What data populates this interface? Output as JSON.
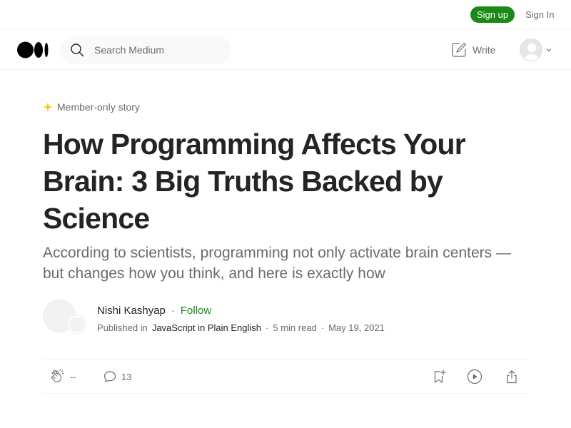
{
  "auth": {
    "signup_label": "Sign up",
    "signin_label": "Sign In"
  },
  "header": {
    "search_placeholder": "Search Medium",
    "write_label": "Write"
  },
  "article": {
    "member_badge": "Member-only story",
    "title": "How Programming Affects Your Brain: 3 Big Truths Backed by Science",
    "subtitle": "According to scientists, programming not only activate brain centers — but changes how you think, and here is exactly how",
    "author": {
      "name": "Nishi Kashyap",
      "separator": "·",
      "follow_label": "Follow"
    },
    "meta": {
      "published_in": "Published in",
      "publication": "JavaScript in Plain English",
      "separator": "·",
      "read_time": "5 min read",
      "date": "May 19, 2021"
    }
  },
  "actions": {
    "claps": "--",
    "responses": "13"
  },
  "colors": {
    "brand_green": "#1a8917",
    "member_star": "#ffc017",
    "text_primary": "#242424",
    "text_secondary": "#6b6b6b"
  },
  "icons": [
    "medium-logo-icon",
    "search-icon",
    "write-icon",
    "avatar-icon",
    "chevron-down-icon",
    "member-star-icon",
    "clap-icon",
    "response-icon",
    "bookmark-add-icon",
    "play-icon",
    "share-icon"
  ]
}
